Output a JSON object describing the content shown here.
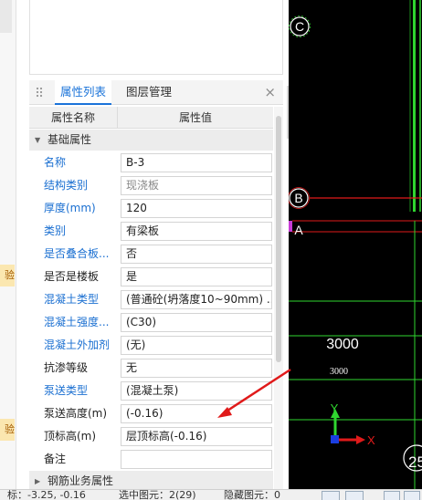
{
  "left_strip": {
    "tag1": "验",
    "tag2": "验"
  },
  "tabs": {
    "properties": "属性列表",
    "layers": "图层管理",
    "close": "×"
  },
  "grid": {
    "col_name": "属性名称",
    "col_value": "属性值",
    "groups": {
      "basic": "基础属性",
      "rebar": "钢筋业务属性"
    },
    "rows": [
      {
        "name": "名称",
        "value": "B-3",
        "blue": true
      },
      {
        "name": "结构类别",
        "value": "现浇板",
        "blue": true,
        "grey": true
      },
      {
        "name": "厚度(mm)",
        "value": "120",
        "blue": true
      },
      {
        "name": "类别",
        "value": "有梁板",
        "blue": true
      },
      {
        "name": "是否叠合板...",
        "value": "否",
        "blue": true
      },
      {
        "name": "是否是楼板",
        "value": "是",
        "blue": false
      },
      {
        "name": "混凝土类型",
        "value": "(普通砼(坍落度10~90mm) ...",
        "blue": true
      },
      {
        "name": "混凝土强度...",
        "value": "(C30)",
        "blue": true
      },
      {
        "name": "混凝土外加剂",
        "value": "(无)",
        "blue": true
      },
      {
        "name": "抗渗等级",
        "value": "无",
        "blue": false
      },
      {
        "name": "泵送类型",
        "value": "(混凝土泵)",
        "blue": true
      },
      {
        "name": "泵送高度(m)",
        "value": "(-0.16)",
        "blue": false
      },
      {
        "name": "顶标高(m)",
        "value": "层顶标高(-0.16)",
        "blue": false
      },
      {
        "name": "备注",
        "value": "",
        "blue": false
      }
    ]
  },
  "cad": {
    "axis_c": "C",
    "axis_b": "B",
    "axis_a": "A",
    "dim_large": "3000",
    "dim_small": "3000",
    "ucs_y": "Y",
    "ucs_x": "X",
    "corner_label": "25",
    "colors": {
      "grid_green": "#2fd62f",
      "red": "#e01a1a",
      "magenta": "#c83cd6"
    }
  },
  "status": {
    "coord": "标：-3.25, -0.16",
    "selected": "选中图元：2(29)",
    "hidden": "隐藏图元：0"
  }
}
